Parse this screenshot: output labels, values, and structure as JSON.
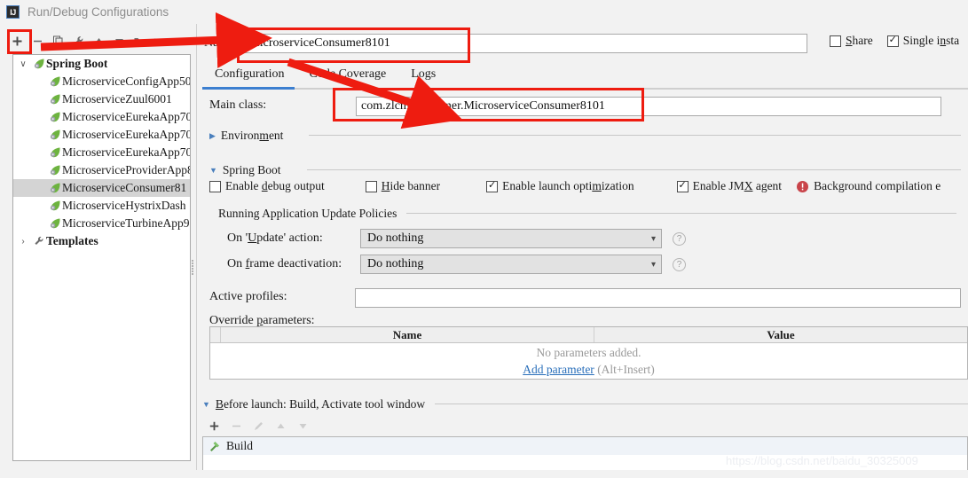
{
  "window": {
    "title": "Run/Debug Configurations",
    "app_icon": "intellij-idea-icon",
    "icon_text": "IJ"
  },
  "left_toolbar": {
    "buttons": [
      {
        "name": "add-configuration-button",
        "icon": "plus-icon",
        "label": "+",
        "enabled": true
      },
      {
        "name": "remove-configuration-button",
        "icon": "minus-icon",
        "label": "−",
        "enabled": true
      },
      {
        "name": "copy-configuration-button",
        "icon": "copy-icon",
        "label": "Copy",
        "enabled": true
      },
      {
        "name": "edit-templates-button",
        "icon": "wrench-icon",
        "label": "Edit Templates",
        "enabled": true
      },
      {
        "name": "move-up-button",
        "icon": "arrow-up-icon",
        "label": "Move Up",
        "enabled": true
      },
      {
        "name": "move-down-button",
        "icon": "arrow-down-icon",
        "label": "Move Down",
        "enabled": true
      },
      {
        "name": "move-into-folder-button",
        "icon": "folder-icon",
        "label": "Create Folder",
        "enabled": true
      },
      {
        "name": "sort-configurations-button",
        "icon": "sort-alphabetically-icon",
        "label": "Sort",
        "enabled": false
      }
    ]
  },
  "tree": {
    "items": [
      {
        "label": "Spring Boot",
        "icon": "spring-boot-icon",
        "twisty": "∨",
        "level": 0,
        "group": true,
        "selected": false
      },
      {
        "label": "MicroserviceConfigApp50",
        "icon": "spring-boot-icon",
        "level": 1,
        "group": false,
        "selected": false
      },
      {
        "label": "MicroserviceZuul6001",
        "icon": "spring-boot-icon",
        "level": 1,
        "group": false,
        "selected": false
      },
      {
        "label": "MicroserviceEurekaApp70",
        "icon": "spring-boot-icon",
        "level": 1,
        "group": false,
        "selected": false
      },
      {
        "label": "MicroserviceEurekaApp70",
        "icon": "spring-boot-icon",
        "level": 1,
        "group": false,
        "selected": false
      },
      {
        "label": "MicroserviceEurekaApp70",
        "icon": "spring-boot-icon",
        "level": 1,
        "group": false,
        "selected": false
      },
      {
        "label": "MicroserviceProviderApp8",
        "icon": "spring-boot-icon",
        "level": 1,
        "group": false,
        "selected": false
      },
      {
        "label": "MicroserviceConsumer81",
        "icon": "spring-boot-icon",
        "level": 1,
        "group": false,
        "selected": true
      },
      {
        "label": "MicroserviceHystrixDash",
        "icon": "spring-boot-icon",
        "level": 1,
        "group": false,
        "selected": false
      },
      {
        "label": "MicroserviceTurbineApp9",
        "icon": "spring-boot-icon",
        "level": 1,
        "group": false,
        "selected": false
      },
      {
        "label": "Templates",
        "icon": "wrench-icon",
        "twisty": "›",
        "level": 0,
        "group": true,
        "selected": false
      }
    ]
  },
  "header": {
    "name_label": "Name:",
    "name_value": "MicroserviceConsumer8101",
    "name_placeholder": "",
    "share_label": "Share",
    "share_checked": false,
    "single_instance_label": "Single insta",
    "single_instance_checked": true
  },
  "tabs": [
    {
      "label": "Configuration",
      "active": true
    },
    {
      "label": "Code Coverage",
      "active": false
    },
    {
      "label": "Logs",
      "active": false
    }
  ],
  "configuration": {
    "main_class_label": "Main class:",
    "main_class_value": "com.zlcm.consumer.MicroserviceConsumer8101",
    "environment_label": "Environment",
    "spring_boot_label": "Spring Boot",
    "checkboxes": [
      {
        "name": "enable-debug-output-checkbox",
        "label": "Enable debug output",
        "checked": false
      },
      {
        "name": "hide-banner-checkbox",
        "label": "Hide banner",
        "checked": false
      },
      {
        "name": "enable-launch-optimization-checkbox",
        "label": "Enable launch optimization",
        "checked": true
      },
      {
        "name": "enable-jmx-agent-checkbox",
        "label": "Enable JMX agent",
        "checked": true
      }
    ],
    "warning_text": "Background compilation e",
    "warning_icon": "error-circle-icon",
    "update_policies_label": "Running Application Update Policies",
    "on_update_label": "On 'Update' action:",
    "on_update_value": "Do nothing",
    "on_frame_label": "On frame deactivation:",
    "on_frame_value": "Do nothing",
    "active_profiles_label": "Active profiles:",
    "active_profiles_value": "",
    "override_parameters_label": "Override parameters:",
    "table": {
      "columns": [
        "Name",
        "Value"
      ],
      "rows": [],
      "empty_text": "No parameters added.",
      "add_link": "Add parameter",
      "add_hint": "(Alt+Insert)"
    }
  },
  "before_launch": {
    "header": "Before launch: Build, Activate tool window",
    "toolbar": [
      {
        "name": "add-task-button",
        "icon": "plus-icon",
        "enabled": true
      },
      {
        "name": "remove-task-button",
        "icon": "minus-icon",
        "enabled": false
      },
      {
        "name": "edit-task-button",
        "icon": "pencil-icon",
        "enabled": false
      },
      {
        "name": "move-task-up-button",
        "icon": "arrow-up-icon",
        "enabled": false
      },
      {
        "name": "move-task-down-button",
        "icon": "arrow-down-icon",
        "enabled": false
      }
    ],
    "items": [
      {
        "label": "Build",
        "icon": "build-hammer-icon"
      }
    ]
  },
  "watermark": "https://blog.csdn.net/baidu_30325009",
  "colors": {
    "annotation_red": "#ee1c10",
    "tab_accent": "#3c7fd0",
    "link_blue": "#2a6fba",
    "window_bg": "#f2f2f2",
    "selection_gray": "#d4d4d4",
    "spring_green": "#6db33f"
  }
}
